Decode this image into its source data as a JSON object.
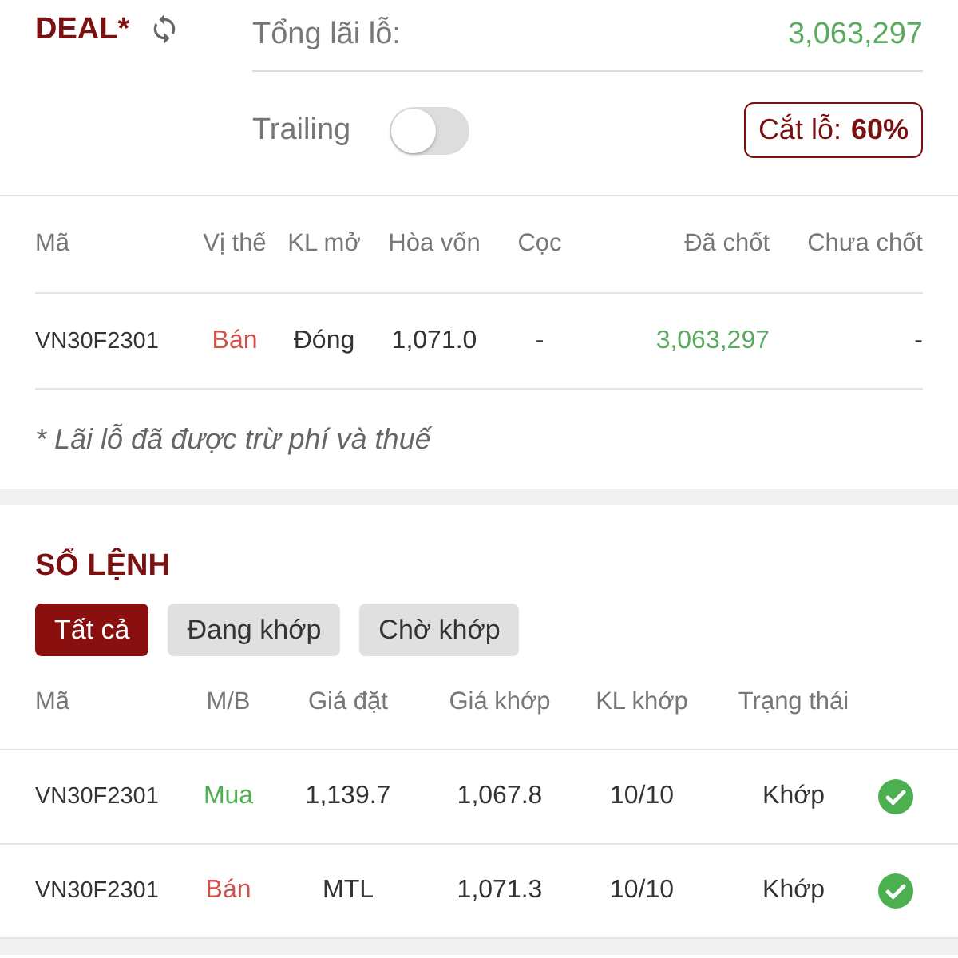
{
  "deal": {
    "title": "DEAL*",
    "pnl_label": "Tổng lãi lỗ:",
    "pnl_value": "3,063,297",
    "trailing_label": "Trailing",
    "trailing_on": false,
    "stop_loss_label": "Cắt lỗ:",
    "stop_loss_value": "60%"
  },
  "positions": {
    "columns": [
      "Mã",
      "Vị thế",
      "KL mở",
      "Hòa vốn",
      "Cọc",
      "Đã chốt",
      "Chưa chốt"
    ],
    "rows": [
      {
        "code": "VN30F2301",
        "side": "Bán",
        "kind": "sell",
        "status": "Đóng",
        "breakeven": "1,071.0",
        "deposit": "-",
        "realized": "3,063,297",
        "unrealized": "-"
      }
    ],
    "note": "* Lãi lỗ đã được trừ phí và thuế"
  },
  "orders": {
    "title": "SỔ LỆNH",
    "tabs": [
      {
        "label": "Tất cả",
        "selected": true
      },
      {
        "label": "Đang khớp",
        "selected": false
      },
      {
        "label": "Chờ khớp",
        "selected": false
      }
    ],
    "columns": [
      "Mã",
      "M/B",
      "Giá đặt",
      "Giá khớp",
      "KL khớp",
      "Trạng thái"
    ],
    "rows": [
      {
        "code": "VN30F2301",
        "side": "Mua",
        "kind": "buy",
        "price": "1,139.7",
        "matched_price": "1,067.8",
        "matched_qty": "10/10",
        "status": "Khớp",
        "done": true
      },
      {
        "code": "VN30F2301",
        "side": "Bán",
        "kind": "sell",
        "price": "MTL",
        "matched_price": "1,071.3",
        "matched_qty": "10/10",
        "status": "Khớp",
        "done": true
      }
    ]
  }
}
